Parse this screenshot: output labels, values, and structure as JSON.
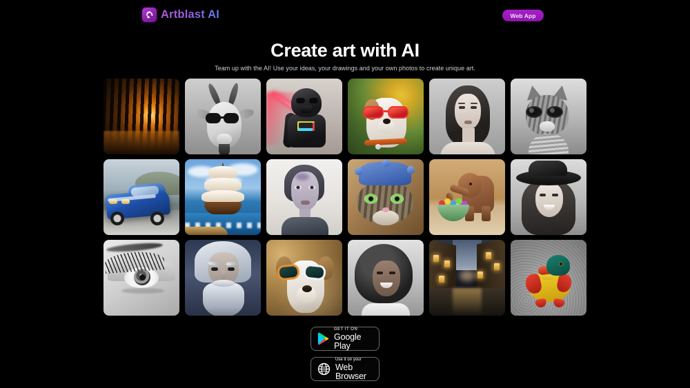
{
  "header": {
    "brand_name": "Artblast AI",
    "brand_icon": "artblast-spiral-icon",
    "web_app_button": "Web App"
  },
  "hero": {
    "title": "Create art with AI",
    "subtitle": "Team up with the AI! Use your ideas, your drawings and your own photos to create unique art."
  },
  "gallery": {
    "columns": 6,
    "rows": 3,
    "items": [
      {
        "alt": "Sunlit forest at sunset",
        "style": "a-forest"
      },
      {
        "alt": "Black and white goat wearing sunglasses",
        "style": "a-goat"
      },
      {
        "alt": "Darth Vader figurine with red lightsaber",
        "style": "a-vader"
      },
      {
        "alt": "Dog wearing red mirrored sunglasses",
        "style": "a-dogred"
      },
      {
        "alt": "Black and white portrait of a woman",
        "style": "a-bww"
      },
      {
        "alt": "Black and white cat wearing sunglasses",
        "style": "a-bwcat"
      },
      {
        "alt": "Blue sports car on a mountain road",
        "style": "a-car"
      },
      {
        "alt": "Tall sailing ship on the open sea",
        "style": "a-ship"
      },
      {
        "alt": "Sketched portrait of a young person",
        "style": "a-sketch"
      },
      {
        "alt": "Cat wearing a blue jester hat",
        "style": "a-catjest"
      },
      {
        "alt": "Wooden elephant beside a bowl of candy",
        "style": "a-eleph"
      },
      {
        "alt": "Black and white smiling woman in a hat",
        "style": "a-hatw"
      },
      {
        "alt": "Black and white macro close-up of an eye",
        "style": "a-eye"
      },
      {
        "alt": "Wizard with long white hair and beard",
        "style": "a-wiz"
      },
      {
        "alt": "Dog wearing orange and white sunglasses",
        "style": "a-dogsg"
      },
      {
        "alt": "Black and white smiling woman with afro",
        "style": "a-afro"
      },
      {
        "alt": "Night street with glowing windows",
        "style": "a-street"
      },
      {
        "alt": "Colorful wooden toy duck",
        "style": "a-duck"
      }
    ]
  },
  "badges": [
    {
      "icon": "google-play-icon",
      "small": "GET IT ON",
      "big": "Google Play"
    },
    {
      "icon": "globe-icon",
      "small": "Use it on your",
      "big": "Web Browser"
    }
  ],
  "colors": {
    "background": "#000000",
    "accent_purple": "#a81fcb",
    "brand_gradient_start": "#b05ad8",
    "brand_gradient_end": "#5f7ce8",
    "text_primary": "#ffffff",
    "text_secondary": "#cfcfcf"
  }
}
